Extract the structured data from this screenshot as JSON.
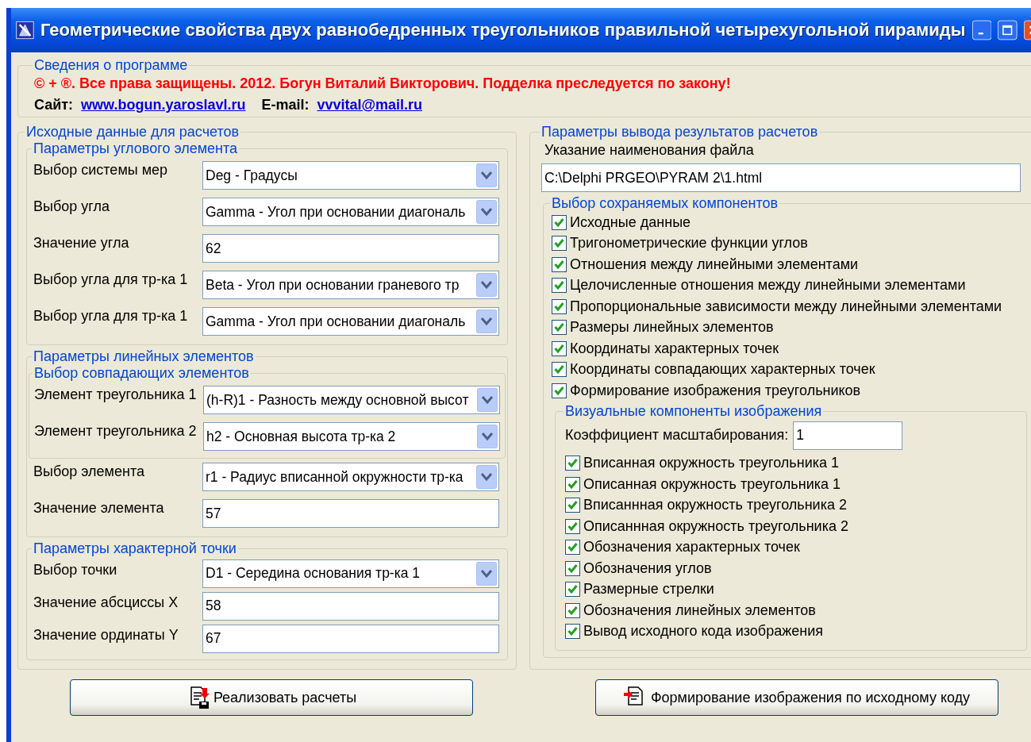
{
  "window": {
    "title": "Геометрические свойства двух равнобедренных треугольников правильной четырехугольной пирамиды"
  },
  "about": {
    "legend": "Сведения о программе",
    "copyright": "© + ®. Все права защищены. 2012. Богун Виталий Викторович. Подделка преследуется по закону!",
    "site_label": "Сайт:",
    "site_link": "www.bogun.yaroslavl.ru",
    "email_label": "E-mail:",
    "email_link": "vvvital@mail.ru"
  },
  "input_group": {
    "legend": "Исходные данные для расчетов",
    "sections": [
      {
        "legend": "Параметры углового элемента",
        "fields": [
          {
            "kind": "combo",
            "label": "Выбор системы мер",
            "value": "Deg - Градусы"
          },
          {
            "kind": "combo",
            "label": "Выбор угла",
            "value": "Gamma - Угол при основании диагональ"
          },
          {
            "kind": "text",
            "label": "Значение угла",
            "value": "62"
          },
          {
            "kind": "combo",
            "label": "Выбор угла для тр-ка 1",
            "value": "Beta - Угол при основании граневого тр"
          },
          {
            "kind": "combo",
            "label": "Выбор угла для тр-ка 1",
            "value": "Gamma - Угол при основании диагональ"
          }
        ]
      },
      {
        "legend": "Параметры линейных элементов",
        "subgroup": {
          "legend": "Выбор совпадающих элементов",
          "fields": [
            {
              "kind": "combo",
              "label": "Элемент треугольника 1",
              "value": "(h-R)1 - Разность между основной высот"
            },
            {
              "kind": "combo",
              "label": "Элемент треугольника 2",
              "value": "h2 - Основная высота тр-ка 2"
            }
          ]
        },
        "fields": [
          {
            "kind": "combo",
            "label": "Выбор элемента",
            "value": "r1 - Радиус вписанной окружности тр-ка"
          },
          {
            "kind": "text",
            "label": "Значение элемента",
            "value": "57"
          }
        ]
      },
      {
        "legend": "Параметры характерной точки",
        "fields": [
          {
            "kind": "combo",
            "label": "Выбор точки",
            "value": "D1 - Середина основания тр-ка 1"
          },
          {
            "kind": "text",
            "label": "Значение абсциссы X",
            "value": "58"
          },
          {
            "kind": "text",
            "label": "Значение ординаты Y",
            "value": "67"
          }
        ]
      }
    ]
  },
  "output_group": {
    "legend": "Параметры вывода результатов расчетов",
    "file_label": "Указание наименования файла",
    "file_value": "C:\\Delphi PRGEO\\PYRAM 2\\1.html",
    "components": {
      "legend": "Выбор сохраняемых компонентов",
      "items": [
        {
          "label": "Исходные данные",
          "checked": true
        },
        {
          "label": "Тригонометрические функции углов",
          "checked": true
        },
        {
          "label": "Отношения между линейными элементами",
          "checked": true
        },
        {
          "label": "Целочисленные отношения между линейными элементами",
          "checked": true
        },
        {
          "label": "Пропорциональные зависимости между линейными элементами",
          "checked": true
        },
        {
          "label": "Размеры линейных элементов",
          "checked": true
        },
        {
          "label": "Координаты характерных точек",
          "checked": true
        },
        {
          "label": "Координаты совпадающих характерных точек",
          "checked": true
        },
        {
          "label": "Формирование изображения треугольников",
          "checked": true
        }
      ],
      "visual": {
        "legend": "Визуальные компоненты изображения",
        "scale_label": "Коэффициент масштабирования:",
        "scale_value": "1",
        "items": [
          {
            "label": "Вписанная окружность треугольника 1",
            "checked": true
          },
          {
            "label": "Описанная окружность треугольника 1",
            "checked": true
          },
          {
            "label": "Вписаннная окружность треугольника 2",
            "checked": true
          },
          {
            "label": "Описаннная окружность треугольника 2",
            "checked": true
          },
          {
            "label": "Обозначения характерных точек",
            "checked": true
          },
          {
            "label": "Обозначения углов",
            "checked": true
          },
          {
            "label": "Размерные стрелки",
            "checked": true
          },
          {
            "label": "Обозначения  линейных элементов",
            "checked": true
          },
          {
            "label": "Вывод исходного кода изображения",
            "checked": true
          }
        ]
      }
    }
  },
  "buttons": [
    {
      "label": "Реализовать расчеты"
    },
    {
      "label": "Формирование изображения по исходному коду"
    }
  ]
}
